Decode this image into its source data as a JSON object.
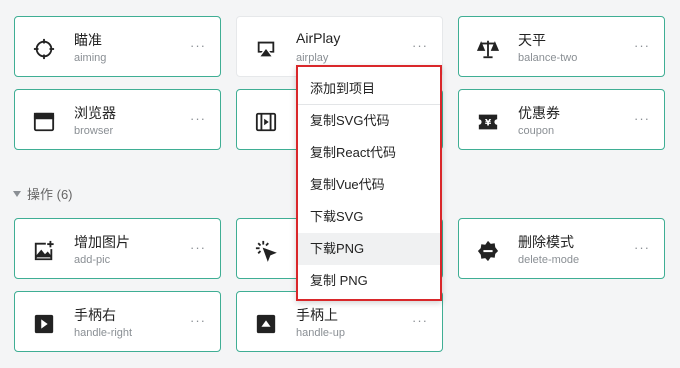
{
  "colors": {
    "accent_border": "#3fae94",
    "highlight_outline": "#d9272a"
  },
  "section": {
    "label": "操作 (6)"
  },
  "cards": {
    "aiming": {
      "title": "瞄准",
      "subtitle": "aiming",
      "more": "···",
      "icon": "crosshair-icon"
    },
    "airplay": {
      "title": "AirPlay",
      "subtitle": "airplay",
      "more": "···",
      "icon": "airplay-icon"
    },
    "balance": {
      "title": "天平",
      "subtitle": "balance-two",
      "more": "···",
      "icon": "balance-scale-icon"
    },
    "browser": {
      "title": "浏览器",
      "subtitle": "browser",
      "more": "···",
      "icon": "browser-window-icon"
    },
    "hidden_row2": {
      "icon": "slides-icon"
    },
    "coupon": {
      "title": "优惠券",
      "subtitle": "coupon",
      "more": "···",
      "icon": "coupon-icon"
    },
    "add_pic": {
      "title": "增加图片",
      "subtitle": "add-pic",
      "more": "···",
      "icon": "add-picture-icon"
    },
    "hidden_row3": {
      "icon": "click-cursor-icon"
    },
    "delete_mode": {
      "title": "删除模式",
      "subtitle": "delete-mode",
      "more": "···",
      "icon": "delete-mode-icon"
    },
    "handle_right": {
      "title": "手柄右",
      "subtitle": "handle-right",
      "more": "···",
      "icon": "handle-right-icon"
    },
    "handle_up": {
      "title": "手柄上",
      "subtitle": "handle-up",
      "more": "···",
      "icon": "handle-up-icon"
    }
  },
  "context_menu": {
    "items": [
      "添加到项目",
      "复制SVG代码",
      "复制React代码",
      "复制Vue代码",
      "下载SVG",
      "下载PNG",
      "复制 PNG"
    ],
    "hovered": "下载PNG"
  }
}
